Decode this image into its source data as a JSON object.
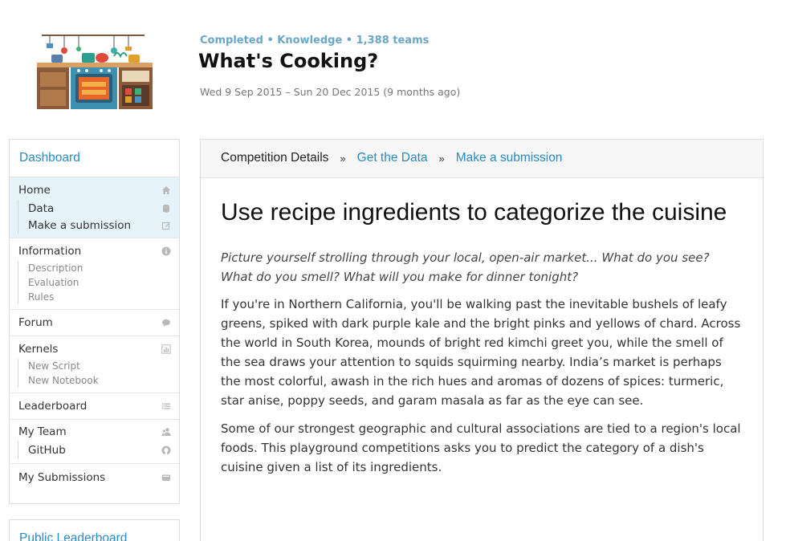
{
  "competition": {
    "meta": "Completed • Knowledge • 1,388 teams",
    "title": "What's Cooking?",
    "dates": "Wed 9 Sep 2015 – Sun 20 Dec 2015 (9 months ago)"
  },
  "sidebar": {
    "header": "Dashboard",
    "groups": [
      {
        "label": "Home",
        "icon": "home-icon",
        "active": true,
        "sub": [
          {
            "label": "Data",
            "icon": "database-icon"
          },
          {
            "label": "Make a submission",
            "icon": "edit-icon"
          }
        ]
      },
      {
        "label": "Information",
        "icon": "info-icon",
        "sub": [
          {
            "label": "Description"
          },
          {
            "label": "Evaluation"
          },
          {
            "label": "Rules"
          }
        ]
      },
      {
        "label": "Forum",
        "icon": "chat-icon"
      },
      {
        "label": "Kernels",
        "icon": "bar-chart-icon",
        "sub": [
          {
            "label": "New Script"
          },
          {
            "label": "New Notebook"
          }
        ]
      },
      {
        "label": "Leaderboard",
        "icon": "list-icon"
      },
      {
        "label": "My Team",
        "icon": "team-icon",
        "sub": [
          {
            "label": "GitHub",
            "icon": "github-icon"
          }
        ]
      },
      {
        "label": "My Submissions",
        "icon": "inbox-icon"
      }
    ],
    "public_leaderboard": "Public Leaderboard"
  },
  "breadcrumbs": {
    "current": "Competition Details",
    "get_data": "Get the Data",
    "submission": "Make a submission",
    "separator": "»"
  },
  "main": {
    "headline": "Use recipe ingredients to categorize the cuisine",
    "lead": "Picture yourself strolling through your local, open-air market... What do you see? What do you smell? What will you make for dinner tonight?",
    "para1": "If you're in Northern California, you'll be walking past the inevitable bushels of leafy greens, spiked with dark purple kale and the bright pinks and yellows of chard. Across the world in South Korea, mounds of bright red kimchi greet you, while the smell of the sea draws your attention to squids squirming nearby. India’s market is perhaps the most colorful, awash in the rich hues and aromas of dozens of spices: turmeric, star anise, poppy seeds, and garam masala as far as the eye can see.",
    "para2": "Some of our strongest geographic and cultural associations are tied to a region's local foods. This playground competitions asks you to predict the category of a dish's cuisine given a list of its ingredients."
  },
  "colors": {
    "link": "#2a8bc0",
    "meta": "#6aa6c6",
    "active_bg": "#e7f3fb"
  }
}
